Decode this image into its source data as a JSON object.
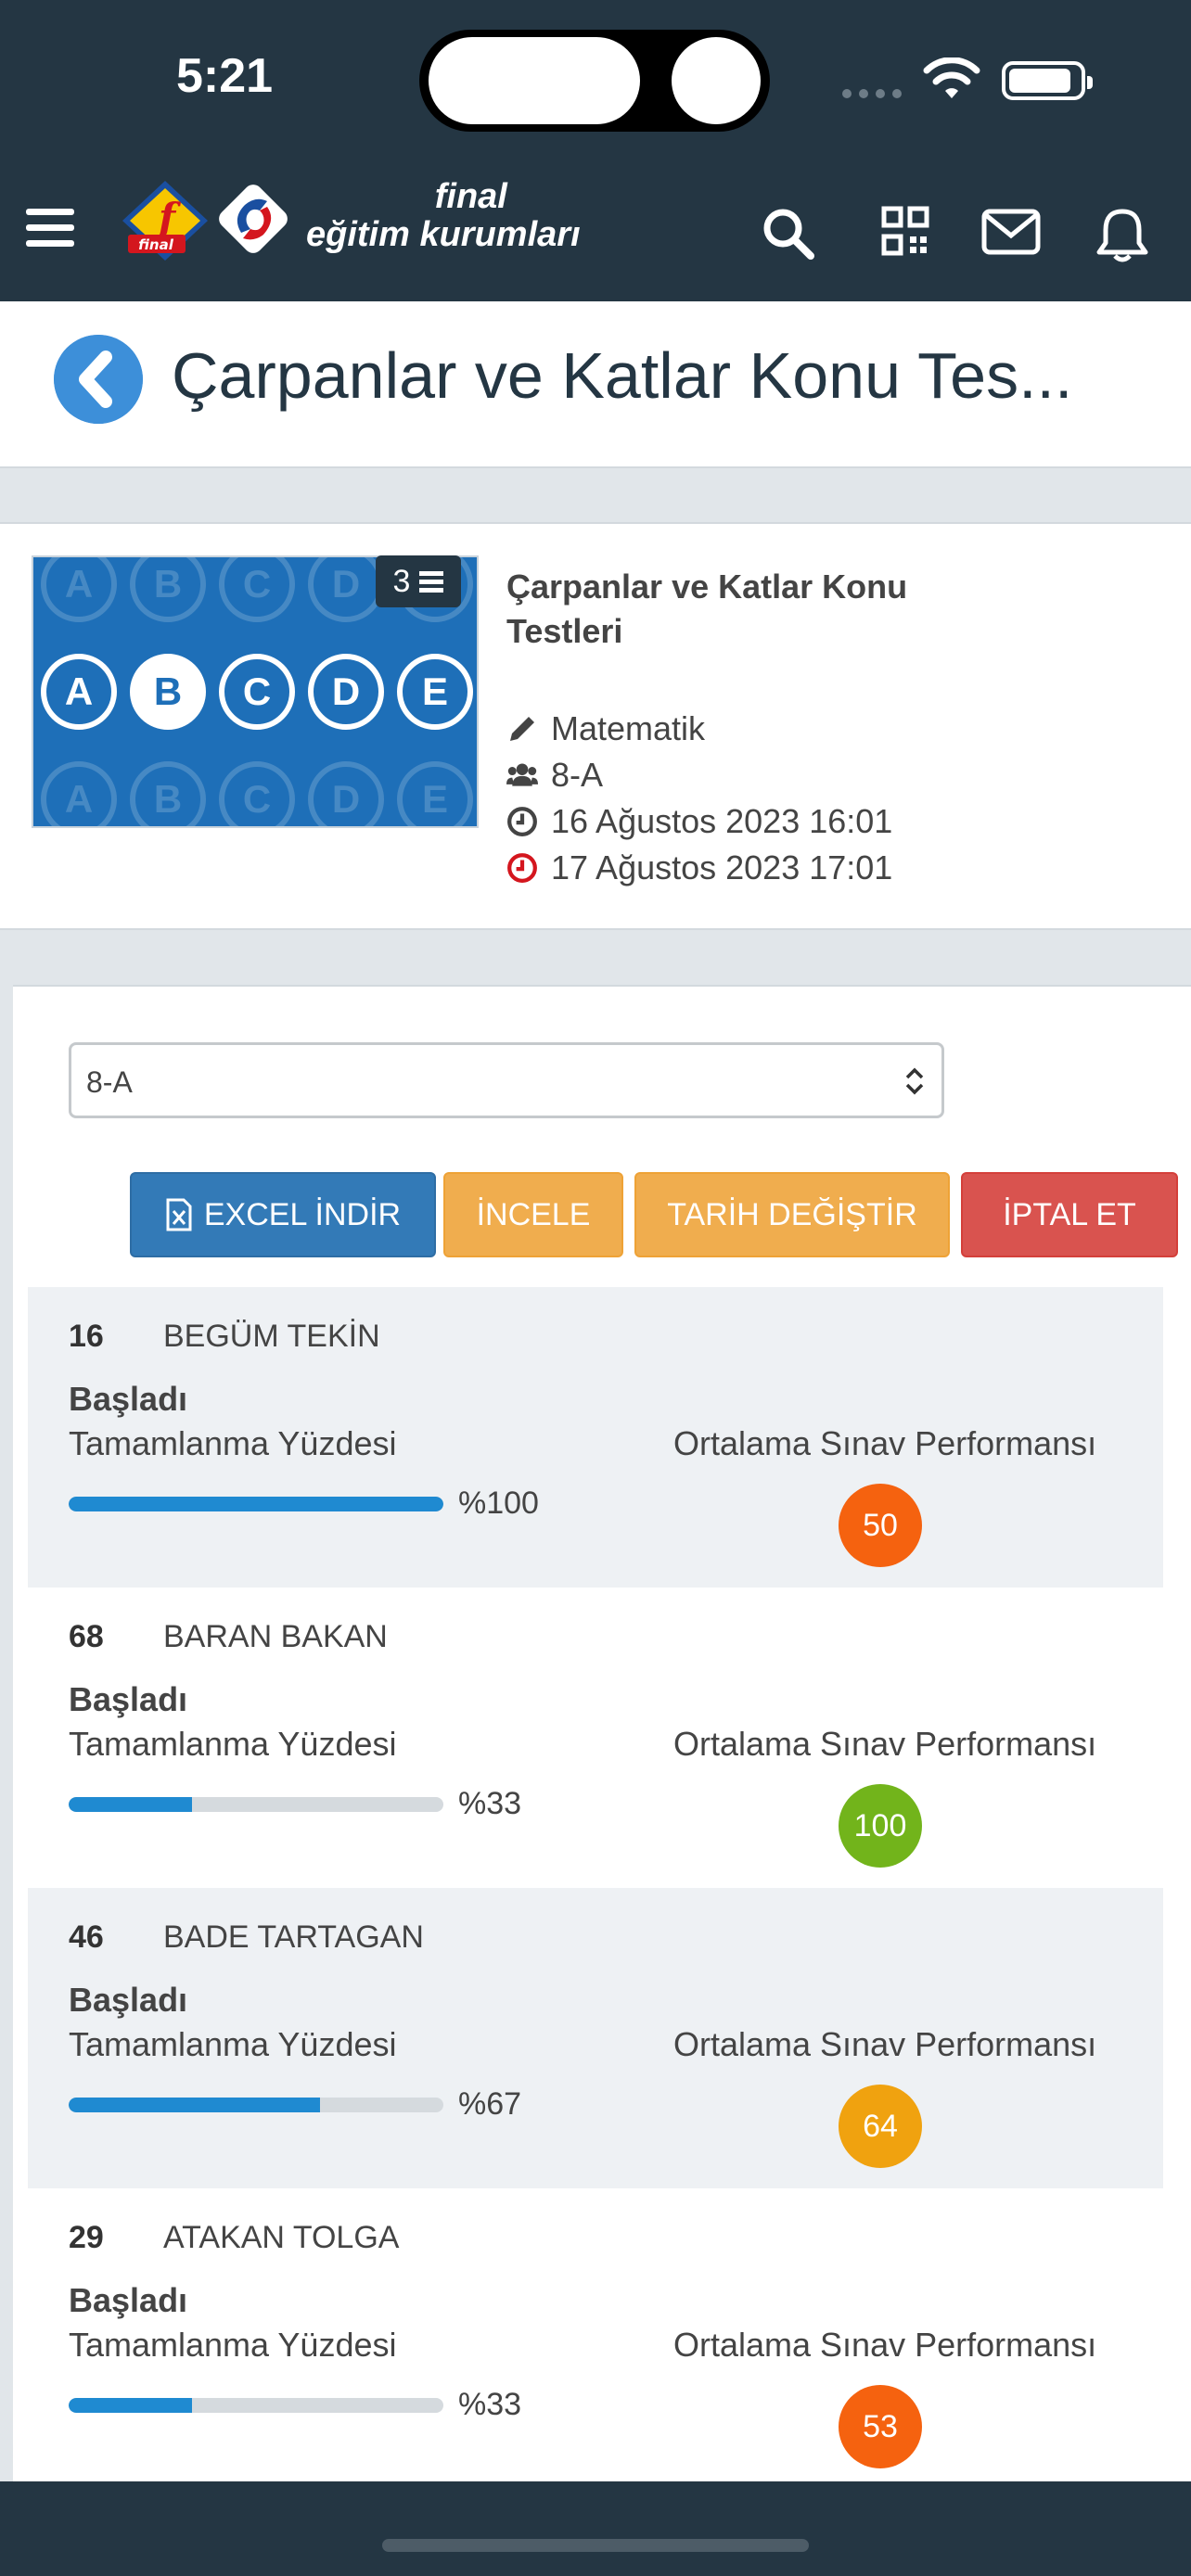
{
  "status": {
    "time": "5:21"
  },
  "header": {
    "brand_line1": "final",
    "brand_line2": "eğitim kurumları"
  },
  "page": {
    "title": "Çarpanlar ve Katlar Konu Tes..."
  },
  "test": {
    "count": "3",
    "title": "Çarpanlar ve Katlar Konu Testleri",
    "subject": "Matematik",
    "class": "8-A",
    "start": "16 Ağustos 2023 16:01",
    "end": "17 Ağustos 2023 17:01",
    "thumb_letters": [
      "A",
      "B",
      "C",
      "D",
      "E"
    ]
  },
  "filter": {
    "selected": "8-A"
  },
  "actions": {
    "excel": "EXCEL İNDİR",
    "incele": "İNCELE",
    "tarih": "TARİH DEĞİŞTİR",
    "iptal": "İPTAL ET"
  },
  "labels": {
    "completion": "Tamamlanma Yüzdesi",
    "performance": "Ortalama Sınav Performansı"
  },
  "students": [
    {
      "number": "16",
      "name": "BEGÜM TEKİN",
      "state": "Başladı",
      "completion": 100,
      "completion_label": "%100",
      "score": "50",
      "score_color": "#f5620f"
    },
    {
      "number": "68",
      "name": "BARAN BAKAN",
      "state": "Başladı",
      "completion": 33,
      "completion_label": "%33",
      "score": "100",
      "score_color": "#72b41b"
    },
    {
      "number": "46",
      "name": "BADE TARTAGAN",
      "state": "Başladı",
      "completion": 67,
      "completion_label": "%67",
      "score": "64",
      "score_color": "#f0a20f"
    },
    {
      "number": "29",
      "name": "ATAKAN TOLGA",
      "state": "Başladı",
      "completion": 33,
      "completion_label": "%33",
      "score": "53",
      "score_color": "#f5620f"
    }
  ],
  "colors": {
    "header_bg": "#243643",
    "accent_blue": "#337ab7",
    "warning": "#f0ad4e",
    "danger": "#d9534f",
    "progress": "#1f8ad1"
  }
}
